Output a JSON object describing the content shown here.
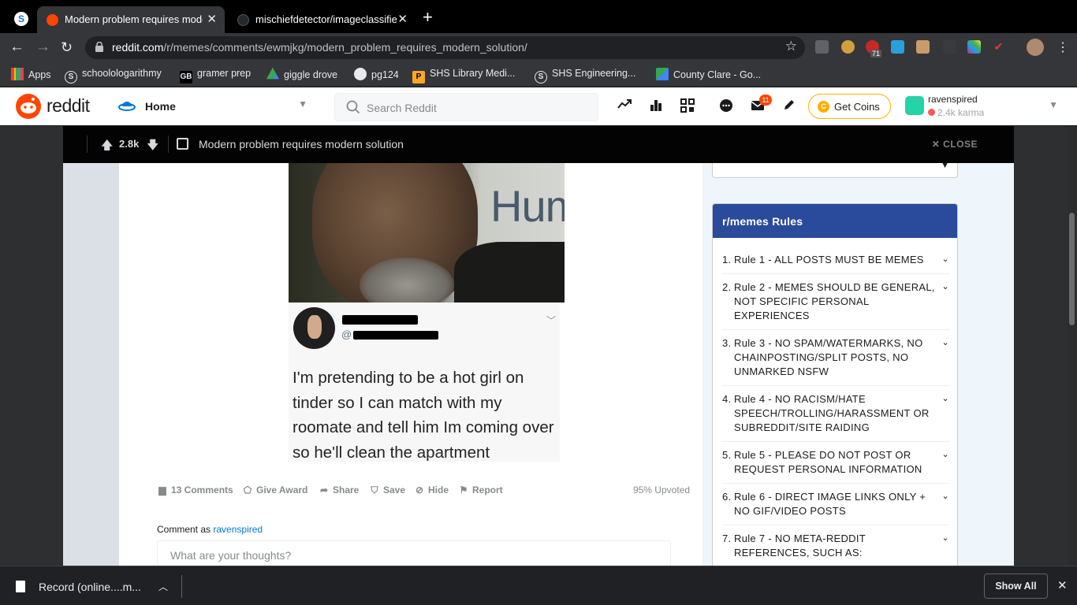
{
  "browser": {
    "tabs": [
      {
        "title": "Modern problem requires modern solution",
        "favicon": "reddit-icon"
      },
      {
        "title": "mischiefdetector/imageclassifier",
        "favicon": "github-icon"
      }
    ],
    "new_tab": "+",
    "url_domain": "reddit.com",
    "url_path": "/r/memes/comments/ewmjkg/modern_problem_requires_modern_solution/",
    "extension_badge": "71",
    "bookmarks": [
      "Apps",
      "schoolologarithmy",
      "gramer prep",
      "giggle drove",
      "pg124",
      "SHS Library Medi...",
      "SHS Engineering...",
      "County Clare - Go..."
    ]
  },
  "reddit": {
    "wordmark": "reddit",
    "home_label": "Home",
    "search_placeholder": "Search Reddit",
    "mail_badge": "11",
    "coins_label": "Get Coins",
    "username": "ravenspired",
    "karma": "2.4k karma"
  },
  "post": {
    "score": "2.8k",
    "title": "Modern problem requires modern solution",
    "close_label": "CLOSE",
    "image_watermark": "Huma",
    "tweet": {
      "handle_prefix": "@",
      "text": "I'm pretending to be a hot girl on tinder so I can match with my roomate and tell him Im coming over so he'll clean the apartment"
    },
    "actions": {
      "comments": "13 Comments",
      "award": "Give Award",
      "share": "Share",
      "save": "Save",
      "hide": "Hide",
      "report": "Report"
    },
    "upvoted": "95% Upvoted",
    "comment_as_label": "Comment as",
    "comment_as_user": "ravenspired",
    "comment_placeholder": "What are your thoughts?"
  },
  "sidebar": {
    "rules_title": "r/memes Rules",
    "rules": [
      {
        "num": "1.",
        "text": "Rule 1 - ALL POSTS MUST BE MEMES"
      },
      {
        "num": "2.",
        "text": "Rule 2 - MEMES SHOULD BE GENERAL, NOT SPECIFIC PERSONAL EXPERIENCES"
      },
      {
        "num": "3.",
        "text": "Rule 3 - NO SPAM/WATERMARKS, NO CHAINPOSTING/SPLIT POSTS, NO UNMARKED NSFW"
      },
      {
        "num": "4.",
        "text": "Rule 4 - NO RACISM/HATE SPEECH/TROLLING/HARASSMENT OR SUBREDDIT/SITE RAIDING"
      },
      {
        "num": "5.",
        "text": "Rule 5 - PLEASE DO NOT POST OR REQUEST PERSONAL INFORMATION"
      },
      {
        "num": "6.",
        "text": "Rule 6 - DIRECT IMAGE LINKS ONLY + NO GIF/VIDEO POSTS"
      },
      {
        "num": "7.",
        "text": "Rule 7 - NO META-REDDIT REFERENCES, SUCH AS:"
      }
    ]
  },
  "downloads": {
    "file_name": "Record (online....m...",
    "show_all": "Show All"
  },
  "colors": {
    "reddit_orange": "#ff4500",
    "rules_header": "#2a4b9b",
    "link_blue": "#0079d3",
    "coins_border": "#ffb000"
  }
}
